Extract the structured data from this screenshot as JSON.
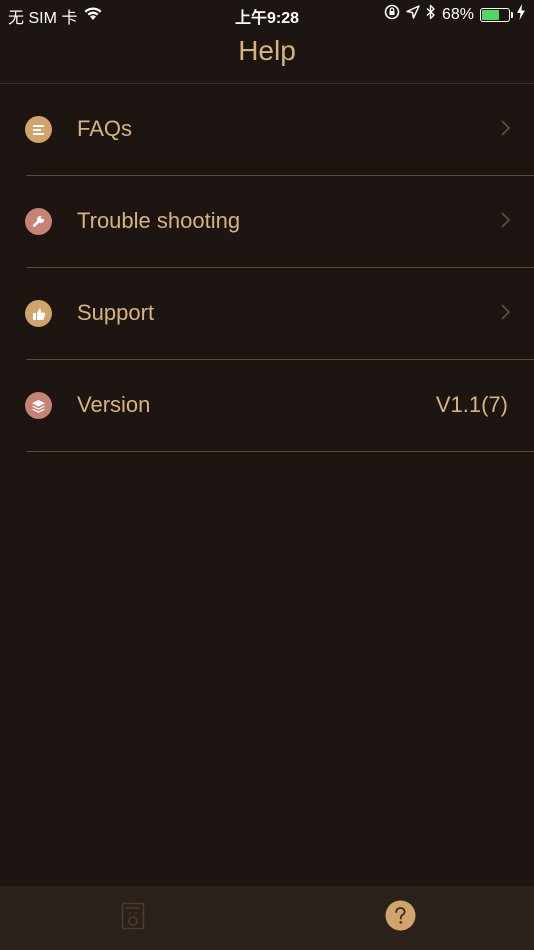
{
  "status_bar": {
    "carrier": "无 SIM 卡",
    "time": "上午9:28",
    "battery_percent": "68%",
    "battery_level": 0.68
  },
  "nav": {
    "title": "Help"
  },
  "menu": {
    "items": [
      {
        "label": "FAQs",
        "icon": "list-icon",
        "color": "#d1a46b"
      },
      {
        "label": "Trouble shooting",
        "icon": "wrench-icon",
        "color": "#c68474"
      },
      {
        "label": "Support",
        "icon": "thumbs-up-icon",
        "color": "#d1a46b"
      },
      {
        "label": "Version",
        "icon": "layers-icon",
        "color": "#c68474",
        "value": "V1.1(7)"
      }
    ]
  },
  "tab_bar": {
    "tabs": [
      {
        "icon": "device-icon",
        "active": false
      },
      {
        "icon": "help-icon",
        "active": true
      }
    ]
  },
  "colors": {
    "background": "#1c1511",
    "accent": "#d8b37c",
    "tab_bar": "#2a211b"
  }
}
